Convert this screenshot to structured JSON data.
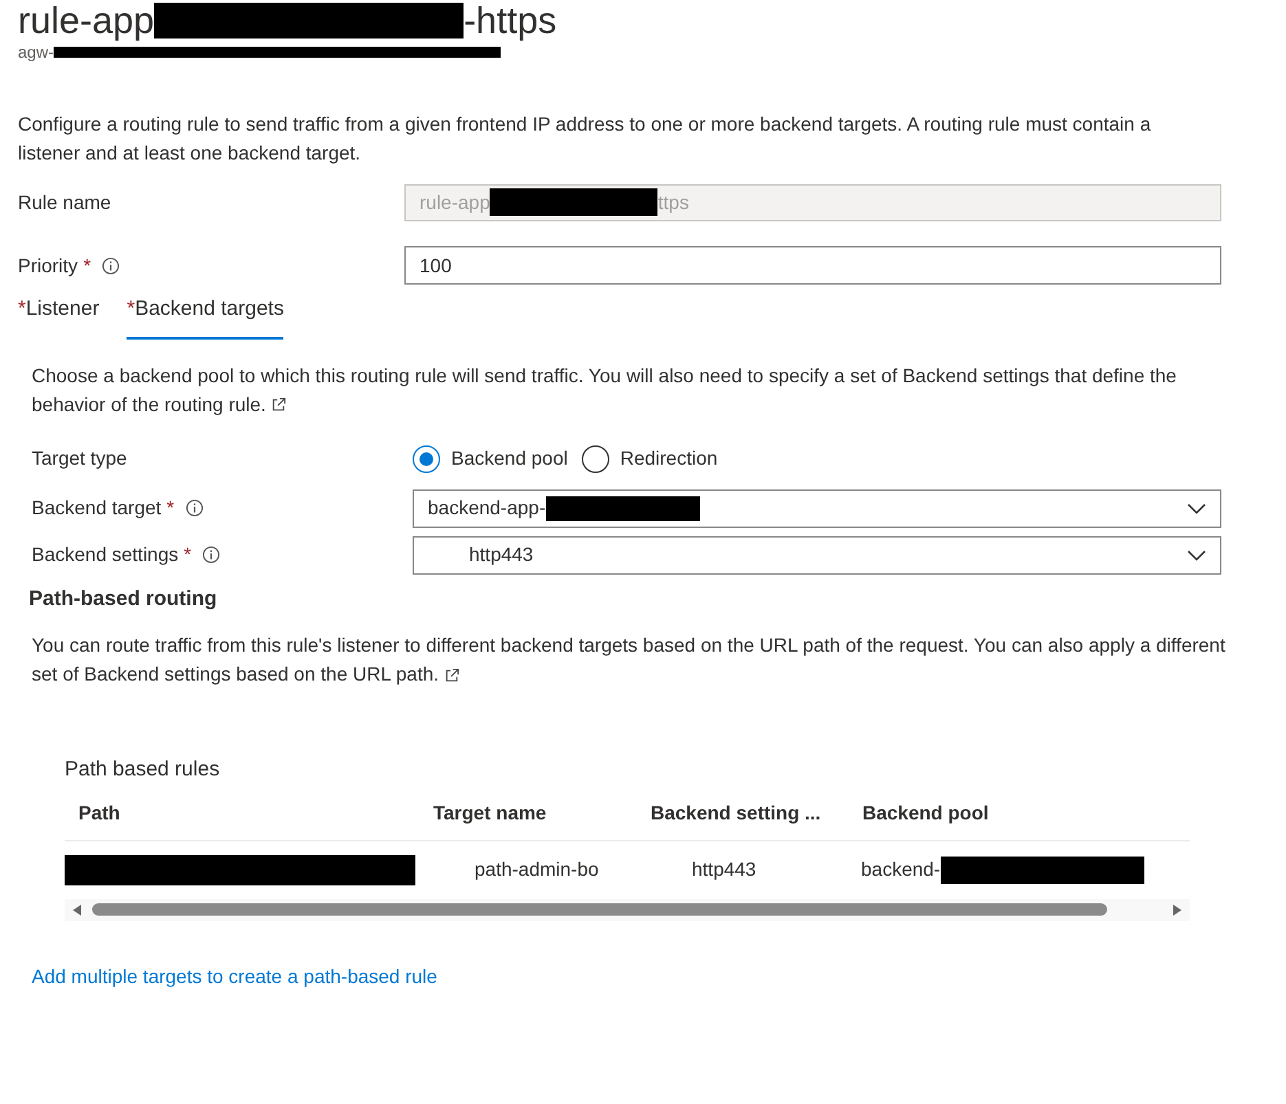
{
  "header": {
    "title_start": "rule-app",
    "title_end": "-https",
    "subtitle_start": "agw-"
  },
  "description": "Configure a routing rule to send traffic from a given frontend IP address to one or more backend targets. A routing rule must contain a listener and at least one backend target.",
  "rule_name": {
    "label": "Rule name",
    "value_start": "rule-app",
    "value_end": "ttps",
    "disabled": true
  },
  "priority": {
    "label": "Priority",
    "required_mark": "*",
    "value": "100"
  },
  "tabs": [
    {
      "label": "Listener",
      "required_mark": "*",
      "selected": false
    },
    {
      "label": "Backend targets",
      "required_mark": "*",
      "selected": true
    }
  ],
  "intro": "Choose a backend pool to which this routing rule will send traffic. You will also need to specify a set of Backend settings that define the behavior of the routing rule.",
  "target_type": {
    "label": "Target type",
    "options": [
      {
        "label": "Backend pool",
        "selected": true
      },
      {
        "label": "Redirection",
        "selected": false
      }
    ]
  },
  "backend_target": {
    "label": "Backend target",
    "required_mark": "*",
    "value_start": "backend-app-"
  },
  "backend_settings": {
    "label": "Backend settings",
    "required_mark": "*",
    "value": "http443"
  },
  "path_routing": {
    "title": "Path-based routing",
    "text": "You can route traffic from this rule's listener to different backend targets based on the URL path of the request. You can also apply a different set of Backend settings based on the URL path."
  },
  "path_rules": {
    "title": "Path based rules",
    "columns": [
      "Path",
      "Target name",
      "Backend setting ...",
      "Backend pool"
    ],
    "rows": [
      {
        "target_name": "path-admin-bo",
        "backend_setting": "http443",
        "backend_pool_start": "backend-"
      }
    ]
  },
  "add_link": "Add multiple targets to create a path-based rule"
}
